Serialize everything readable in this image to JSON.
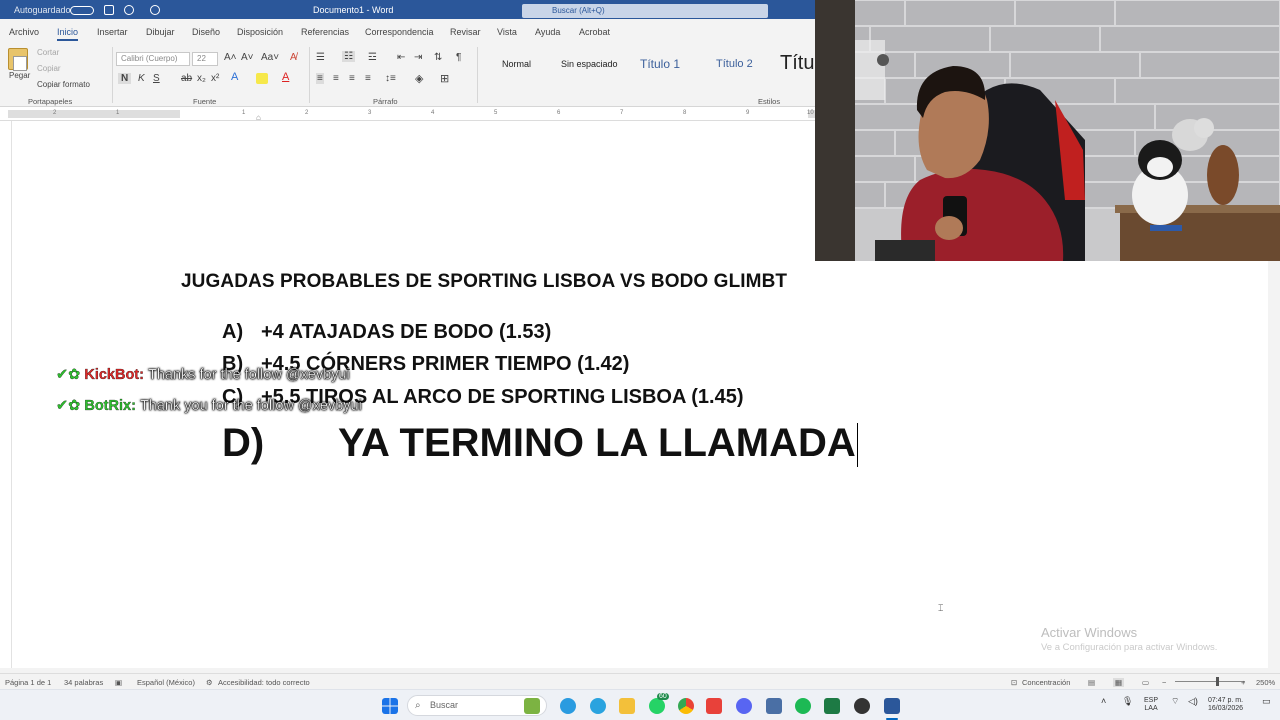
{
  "titlebar": {
    "autosave": "Autoguardado",
    "doc_title": "Documento1 - Word",
    "search_placeholder": "Buscar (Alt+Q)"
  },
  "menu": {
    "tabs": [
      "Archivo",
      "Inicio",
      "Insertar",
      "Dibujar",
      "Diseño",
      "Disposición",
      "Referencias",
      "Correspondencia",
      "Revisar",
      "Vista",
      "Ayuda",
      "Acrobat"
    ],
    "active": "Inicio"
  },
  "ribbon": {
    "paste": "Pegar",
    "cut": "Cortar",
    "copy": "Copiar",
    "format_painter": "Copiar formato",
    "clipboard_group": "Portapapeles",
    "font_name": "Calibri (Cuerpo)",
    "font_size": "22",
    "font_group": "Fuente",
    "paragraph_group": "Párrafo",
    "styles_group": "Estilos",
    "styles": [
      "Normal",
      "Sin espaciado",
      "Título 1",
      "Título 2",
      "Títu"
    ],
    "bold": "N",
    "italic": "K",
    "underline": "S"
  },
  "ruler": {
    "numbers": [
      "2",
      "1",
      "1",
      "2",
      "3",
      "4",
      "5",
      "6",
      "7",
      "8",
      "9",
      "10"
    ]
  },
  "document": {
    "title": "JUGADAS PROBABLES DE SPORTING LISBOA VS BODO GLIMBT",
    "items": [
      {
        "label": "A)",
        "text": "+4 ATAJADAS DE BODO (1.53)"
      },
      {
        "label": "B)",
        "text": "+4.5 CÓRNERS PRIMER TIEMPO (1.42)"
      },
      {
        "label": "C)",
        "text": "+5.5 TIROS AL ARCO DE SPORTING LISBOA (1.45)"
      }
    ],
    "big_item": {
      "label": "D)",
      "text": "YA TERMINO LA LLAMADA"
    }
  },
  "overlay_chat": [
    {
      "bot": "KickBot:",
      "message": "Thanks for the follow @xevbyui",
      "bot_color": "#e02828"
    },
    {
      "bot": "BotRix:",
      "message": "Thank you for the follow @xevbyui",
      "bot_color": "#2fc22f"
    }
  ],
  "watermark": {
    "title": "Activar Windows",
    "subtitle": "Ve a Configuración para activar Windows."
  },
  "statusbar": {
    "page": "Página 1 de 1",
    "words": "34 palabras",
    "language": "Español (México)",
    "accessibility": "Accesibilidad: todo correcto",
    "focus": "Concentración",
    "zoom": "250%"
  },
  "taskbar": {
    "search_placeholder": "Buscar",
    "badge_count": "60",
    "lang_top": "ESP",
    "lang_bottom": "LAA",
    "time": "07:47 p. m.",
    "date": "16/03/2026"
  }
}
